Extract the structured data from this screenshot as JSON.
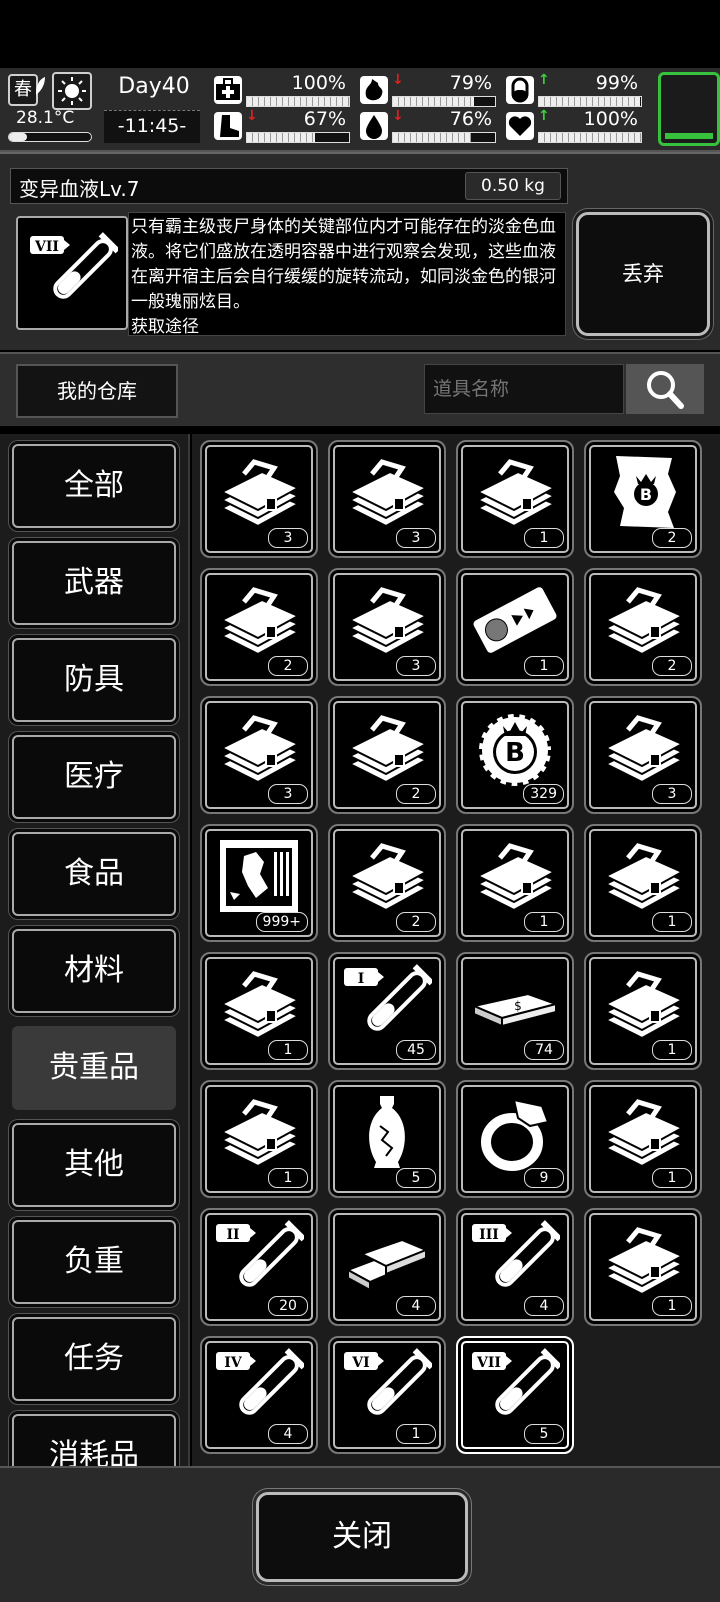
{
  "status": {
    "season": "春",
    "temperature": "28.1°C",
    "temperature_level": 0.22,
    "day": "Day40",
    "clock": "-11:45-",
    "stats": [
      {
        "icon": "medkit-icon",
        "arrow": "",
        "value": "100%",
        "level": 1.0
      },
      {
        "icon": "stomach-icon",
        "arrow": "↓",
        "value": "79%",
        "level": 0.79
      },
      {
        "icon": "pill-icon",
        "arrow": "↑",
        "value": "99%",
        "level": 0.99
      },
      {
        "icon": "boot-icon",
        "arrow": "↓",
        "value": "67%",
        "level": 0.67
      },
      {
        "icon": "water-drop-icon",
        "arrow": "↓",
        "value": "76%",
        "level": 0.76
      },
      {
        "icon": "heart-icon",
        "arrow": "↑",
        "value": "100%",
        "level": 1.0
      }
    ],
    "colors": {
      "up": "#3ad13a",
      "down": "#e02020",
      "battery": "#36c23c"
    }
  },
  "item": {
    "name": "变异血液Lv.7",
    "weight": "0.50 kg",
    "icon": "test-tube-vii-icon",
    "description": "只有霸主级丧尸身体的关键部位内才可能存在的淡金色血液。将它们盛放在透明容器中进行观察会发现，这些血液在离开宿主后会自行缓缓的旋转流动，如同淡金色的银河一般瑰丽炫目。\n获取途径",
    "discard_label": "丢弃"
  },
  "storage": {
    "tab_label": "我的仓库",
    "search_placeholder": "道具名称"
  },
  "categories": [
    "全部",
    "武器",
    "防具",
    "医疗",
    "食品",
    "材料",
    "贵重品",
    "其他",
    "负重",
    "任务",
    "消耗品"
  ],
  "active_category": 6,
  "items": [
    {
      "icon": "case",
      "count": "3"
    },
    {
      "icon": "case",
      "count": "3"
    },
    {
      "icon": "case",
      "count": "1"
    },
    {
      "icon": "map",
      "count": "2"
    },
    {
      "icon": "case",
      "count": "2"
    },
    {
      "icon": "case",
      "count": "3"
    },
    {
      "icon": "ticket",
      "count": "1"
    },
    {
      "icon": "case",
      "count": "2"
    },
    {
      "icon": "case",
      "count": "3"
    },
    {
      "icon": "case",
      "count": "2"
    },
    {
      "icon": "coin",
      "count": "329"
    },
    {
      "icon": "case",
      "count": "3"
    },
    {
      "icon": "poster",
      "count": "999+"
    },
    {
      "icon": "case",
      "count": "2"
    },
    {
      "icon": "case",
      "count": "1"
    },
    {
      "icon": "case",
      "count": "1"
    },
    {
      "icon": "case",
      "count": "1"
    },
    {
      "icon": "tube",
      "roman": "I",
      "count": "45"
    },
    {
      "icon": "cash",
      "count": "74"
    },
    {
      "icon": "case",
      "count": "1"
    },
    {
      "icon": "case",
      "count": "1"
    },
    {
      "icon": "vase",
      "count": "5"
    },
    {
      "icon": "ring",
      "count": "9"
    },
    {
      "icon": "case",
      "count": "1"
    },
    {
      "icon": "tube",
      "roman": "II",
      "count": "20"
    },
    {
      "icon": "gold",
      "count": "4"
    },
    {
      "icon": "tube",
      "roman": "III",
      "count": "4"
    },
    {
      "icon": "case",
      "count": "1"
    },
    {
      "icon": "tube",
      "roman": "IV",
      "count": "4"
    },
    {
      "icon": "tube",
      "roman": "VI",
      "count": "1"
    },
    {
      "icon": "tube",
      "roman": "VII",
      "count": "5"
    }
  ],
  "selected_index": 30,
  "close_label": "关闭"
}
